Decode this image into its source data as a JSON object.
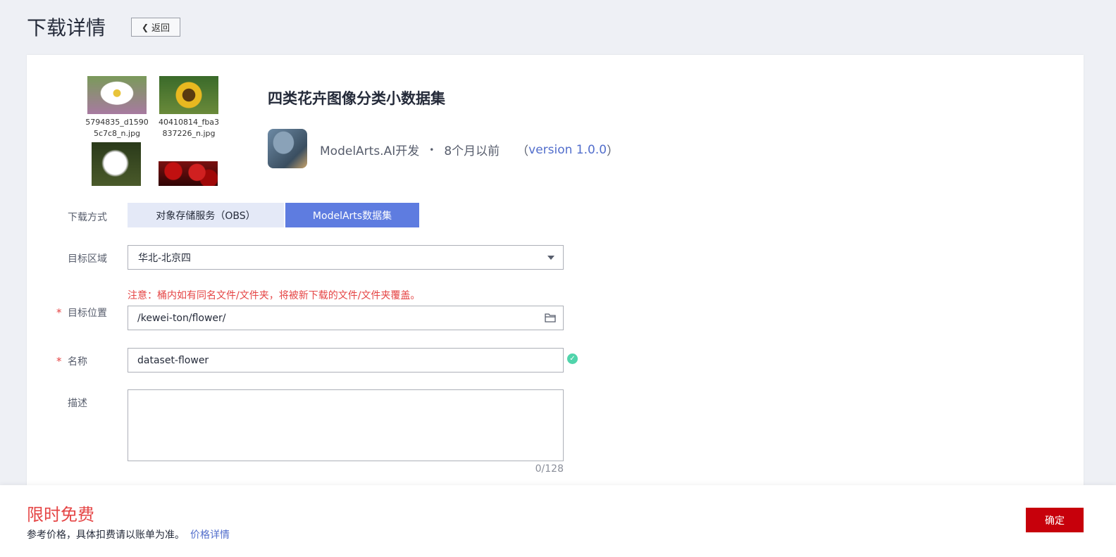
{
  "header": {
    "title": "下载详情",
    "back_label": "返回"
  },
  "thumbnails": [
    {
      "caption": "5794835_d15905c7c8_n.jpg",
      "icon": "daisy-image"
    },
    {
      "caption": "40410814_fba3837226_n.jpg",
      "icon": "sunflower-image"
    },
    {
      "caption": "",
      "icon": "dandelion-image"
    },
    {
      "caption": "",
      "icon": "rose-image"
    }
  ],
  "dataset": {
    "title": "四类花卉图像分类小数据集",
    "publisher": "ModelArts.AI开发",
    "separator": "•",
    "time": "8个月以前",
    "version_open": "（",
    "version": "version 1.0.0",
    "version_close": "）"
  },
  "form": {
    "download_method": {
      "label": "下载方式",
      "options": [
        "对象存储服务（OBS）",
        "ModelArts数据集"
      ],
      "selected": "ModelArts数据集"
    },
    "region": {
      "label": "目标区域",
      "value": "华北-北京四"
    },
    "warning": "注意：桶内如有同名文件/文件夹，将被新下载的文件/文件夹覆盖。",
    "location": {
      "label": "目标位置",
      "required_mark": "*",
      "value": "/kewei-ton/flower/"
    },
    "name": {
      "label": "名称",
      "required_mark": "*",
      "value": "dataset-flower"
    },
    "description": {
      "label": "描述",
      "value": "",
      "counter": "0/128"
    }
  },
  "footer": {
    "free_label": "限时免费",
    "price_note": "参考价格，具体扣费请以账单为准。",
    "price_link": "价格详情",
    "confirm_label": "确定"
  },
  "colors": {
    "accent": "#5e7ce0",
    "danger": "#e54545",
    "confirm": "#c7000b",
    "link": "#526ecc"
  }
}
